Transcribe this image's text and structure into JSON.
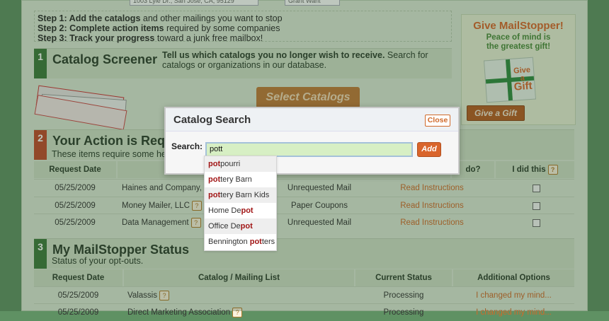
{
  "top": {
    "address_value": "1003 Lyle Dr., San Jose, CA, 95129",
    "gift_select": "Grant Want"
  },
  "steps": [
    {
      "label": "Step 1: Add the catalogs",
      "rest": "and other mailings you want to stop"
    },
    {
      "label": "Step 2: Complete action items",
      "rest": "required by some companies"
    },
    {
      "label": "Step 3: Track your progress",
      "rest": "toward a junk free mailbox!"
    }
  ],
  "gift": {
    "title": "Give MailStopper!",
    "subtitle_line1": "Peace of mind is",
    "subtitle_line2": "the greatest gift!",
    "card_label_1": "Give a",
    "card_label_2": "Gift",
    "button": "Give a Gift"
  },
  "section1": {
    "number": "1",
    "title": "Catalog Screener",
    "desc_bold": "Tell us which catalogs you no longer wish to receive.",
    "desc_rest": "Search for catalogs or organizations in our database.",
    "button": "Select Catalogs"
  },
  "section2": {
    "number": "2",
    "title": "Your Action is Req",
    "subtitle": "These items require some help",
    "headers": {
      "date": "Request Date",
      "todo": "do?",
      "done": "I did this"
    },
    "rows": [
      {
        "date": "05/25/2009",
        "company": "Haines and Company, In",
        "type": "Unrequested Mail",
        "action": "Read Instructions"
      },
      {
        "date": "05/25/2009",
        "company": "Money Mailer, LLC",
        "type": "Paper Coupons",
        "action": "Read Instructions"
      },
      {
        "date": "05/25/2009",
        "company": "Data Management",
        "type": "Unrequested Mail",
        "action": "Read Instructions"
      }
    ]
  },
  "section3": {
    "number": "3",
    "title": "My MailStopper Status",
    "subtitle": "Status of your opt-outs.",
    "headers": {
      "date": "Request Date",
      "catalog": "Catalog / Mailing List",
      "status": "Current Status",
      "options": "Additional Options"
    },
    "rows": [
      {
        "date": "05/25/2009",
        "catalog": "Valassis",
        "status": "Processing",
        "option": "I changed my mind..."
      },
      {
        "date": "05/25/2009",
        "catalog": "Direct Marketing Association",
        "status": "Processing",
        "option": "I changed my mind..."
      }
    ]
  },
  "modal": {
    "title": "Catalog Search",
    "close": "Close",
    "search_label": "Search:",
    "search_value": "pott",
    "add": "Add"
  },
  "suggestions": [
    {
      "pre": "",
      "match": "pot",
      "post": "pourri"
    },
    {
      "pre": "",
      "match": "pot",
      "post": "tery Barn"
    },
    {
      "pre": "",
      "match": "pot",
      "post": "tery Barn Kids"
    },
    {
      "pre": "Home De",
      "match": "pot",
      "post": ""
    },
    {
      "pre": "Office De",
      "match": "pot",
      "post": ""
    },
    {
      "pre": "Bennington ",
      "match": "pot",
      "post": "ters"
    }
  ],
  "help_icon": "?"
}
